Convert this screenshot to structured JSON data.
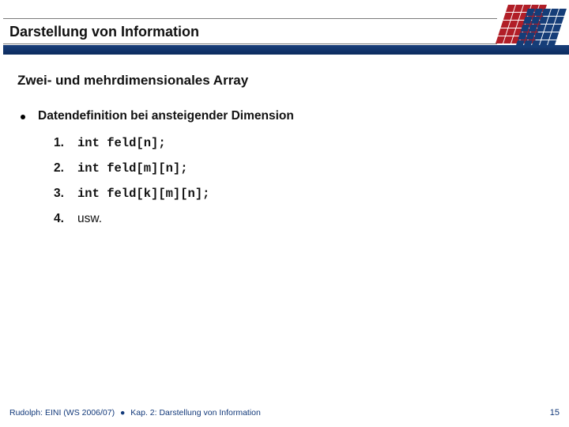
{
  "header": {
    "title": "Darstellung von Information"
  },
  "body": {
    "subtitle": "Zwei- und mehrdimensionales Array",
    "bullet": "Datendefinition bei ansteigender Dimension",
    "items": [
      {
        "n": "1.",
        "code": "int feld[n];"
      },
      {
        "n": "2.",
        "code": "int feld[m][n];"
      },
      {
        "n": "3.",
        "code": "int feld[k][m][n];"
      },
      {
        "n": "4.",
        "code": "usw."
      }
    ]
  },
  "footer": {
    "left1": "Rudolph: EINI (WS 2006/07)",
    "dot": "●",
    "left2": "Kap. 2: Darstellung von Information",
    "page": "15"
  },
  "icons": {
    "grid_red": "grid-red-icon",
    "grid_blue": "grid-blue-icon"
  }
}
